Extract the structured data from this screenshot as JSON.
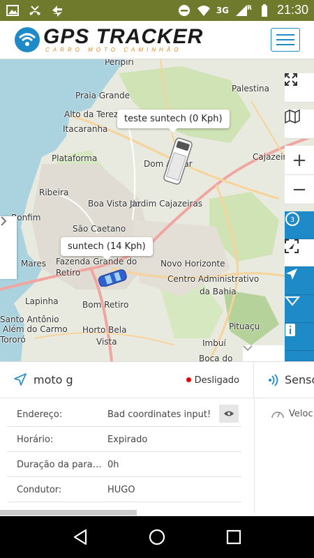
{
  "statusbar": {
    "time": "21:30",
    "network": "3G",
    "roaming": "R",
    "icons": [
      "image-icon",
      "missed-call-icon",
      "sync-icon",
      "do-not-disturb-icon",
      "wifi-icon",
      "signal-icon",
      "battery-icon"
    ]
  },
  "header": {
    "logo_text": "GPS TRACKER",
    "logo_sub": "CARRO MOTO CAMINHÃO",
    "accent": "#1e8ac8",
    "brand_orange": "#e08a2a"
  },
  "map": {
    "labels": [
      "Peripiri",
      "Praia Grande",
      "Alto da Terezinha",
      "Itacaranha",
      "Plataforma",
      "Boa Vista de",
      "São Caetano",
      "Ribeira",
      "Bonfim",
      "Mares",
      "Fazenda Grande do Retiro",
      "Lapinha",
      "Bom Retiro",
      "Santo Antônio",
      "Além do Carmo",
      "Tororó",
      "Horto Bela",
      "Vista",
      "Palestina",
      "Cajazeiras",
      "Dom Avelar",
      "Jardim Cajazeiras",
      "Novo Horizonte",
      "Centro Administrativo",
      "da Bahia",
      "Pituaçu",
      "Imbuí",
      "Boca do"
    ],
    "vehicles": [
      {
        "label": "teste suntech (0 Kph)",
        "type": "truck"
      },
      {
        "label": "suntech (14 Kph)",
        "type": "car"
      }
    ],
    "controls": [
      "fullscreen-icon",
      "layers-icon",
      "zoom-in-icon",
      "zoom-out-icon"
    ],
    "tools": [
      "circle-3-icon",
      "focus-icon",
      "navigate-icon",
      "route-icon",
      "info-icon"
    ],
    "zoom_in": "+",
    "zoom_out": "−"
  },
  "panel": {
    "device_name": "moto g",
    "status": "Desligado",
    "status_color": "#e00000",
    "sensor_tab": "Senso",
    "speed_label": "Veloc",
    "rows": [
      {
        "key": "Endereço:",
        "value": "Bad coordinates input!"
      },
      {
        "key": "Horário:",
        "value": "Expirado"
      },
      {
        "key": "Duração da parada:",
        "value": "0h"
      },
      {
        "key": "Condutor:",
        "value": "HUGO"
      }
    ]
  }
}
